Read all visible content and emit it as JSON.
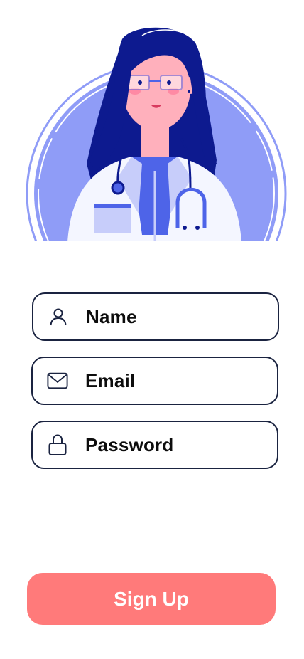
{
  "form": {
    "name_label": "Name",
    "email_label": "Email",
    "password_label": "Password"
  },
  "signup": {
    "label": "Sign Up"
  },
  "icons": {
    "name": "user-icon",
    "email": "mail-icon",
    "password": "lock-icon"
  },
  "colors": {
    "button": "#ff7a7a",
    "field_border": "#1a2340",
    "accent_blue": "#7f8ef5",
    "hair": "#0a1a8c",
    "skin": "#ffb0bc"
  }
}
